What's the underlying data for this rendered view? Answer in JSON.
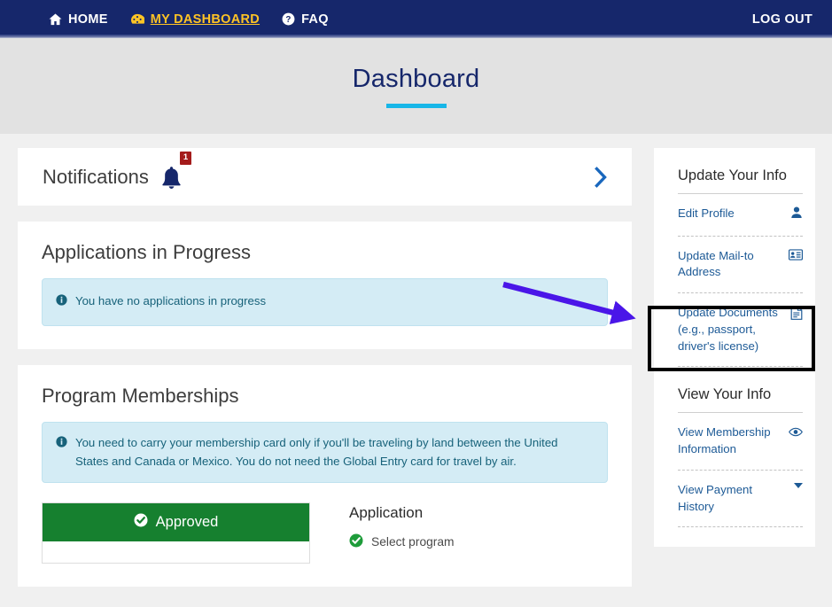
{
  "navbar": {
    "items": [
      {
        "label": "HOME",
        "icon": "home-icon",
        "active": false
      },
      {
        "label": "MY DASHBOARD",
        "icon": "dashboard-gauge-icon",
        "active": true
      },
      {
        "label": "FAQ",
        "icon": "question-circle-icon",
        "active": false
      }
    ],
    "logout_label": "LOG OUT",
    "background": "#16276b",
    "active_color": "#ffc425"
  },
  "header": {
    "title": "Dashboard",
    "rule_color": "#17b6e8",
    "band_background": "#e2e2e2"
  },
  "notifications": {
    "title": "Notifications",
    "badge_count": "1",
    "badge_color": "#a41b1b",
    "bell_icon": "bell-icon",
    "expand_icon": "chevron-right-icon"
  },
  "applications": {
    "title": "Applications in Progress",
    "alert_icon": "info-circle-icon",
    "alert_text": "You have no applications in progress"
  },
  "memberships": {
    "title": "Program Memberships",
    "alert_icon": "info-circle-icon",
    "alert_text": "You need to carry your membership card only if you'll be traveling by land between the United States and Canada or Mexico. You do not need the Global Entry card for travel by air.",
    "status_label": "Approved",
    "status_icon": "check-circle-icon",
    "status_color": "#16802f",
    "application_title": "Application",
    "steps": [
      {
        "label": "Select program",
        "icon": "check-circle-green-icon"
      }
    ]
  },
  "sidebar": {
    "groups": [
      {
        "title": "Update Your Info",
        "items": [
          {
            "label": "Edit Profile",
            "icon": "user-icon",
            "highlighted": false
          },
          {
            "label": "Update Mail-to Address",
            "icon": "id-card-icon",
            "highlighted": false
          },
          {
            "label": "Update Documents (e.g., passport, driver's license)",
            "icon": "document-icon",
            "highlighted": true
          }
        ]
      },
      {
        "title": "View Your Info",
        "items": [
          {
            "label": "View Membership Information",
            "icon": "eye-icon",
            "highlighted": false
          },
          {
            "label": "View Payment History",
            "icon": "caret-down-icon",
            "highlighted": false
          }
        ]
      }
    ],
    "link_color": "#1d5a96"
  },
  "annotations": {
    "highlight_box_color": "#000000",
    "arrow_color": "#4a16e8",
    "arrow_start": "568,321",
    "arrow_end": "712,358"
  }
}
